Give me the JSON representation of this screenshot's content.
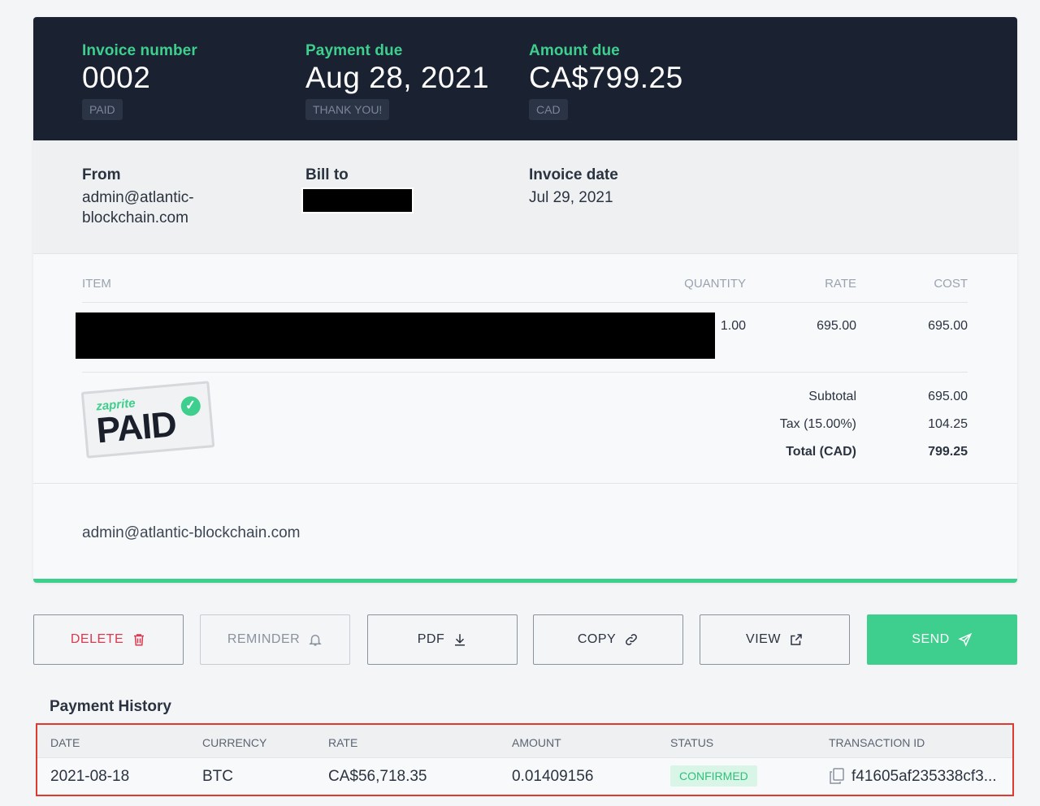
{
  "header": {
    "invoice_number": {
      "label": "Invoice number",
      "value": "0002",
      "badge": "PAID"
    },
    "payment_due": {
      "label": "Payment due",
      "value": "Aug 28, 2021",
      "badge": "THANK YOU!"
    },
    "amount_due": {
      "label": "Amount due",
      "value": "CA$799.25",
      "badge": "CAD"
    }
  },
  "billing": {
    "from_label": "From",
    "from_line1": "admin@atlantic-",
    "from_line2": "blockchain.com",
    "bill_to_label": "Bill to",
    "invoice_date_label": "Invoice date",
    "invoice_date": "Jul 29, 2021"
  },
  "items": {
    "columns": [
      "ITEM",
      "QUANTITY",
      "RATE",
      "COST"
    ],
    "rows": [
      {
        "quantity": "1.00",
        "rate": "695.00",
        "cost": "695.00"
      }
    ]
  },
  "totals": {
    "subtotal_label": "Subtotal",
    "subtotal": "695.00",
    "tax_label": "Tax (15.00%)",
    "tax": "104.25",
    "total_label": "Total (CAD)",
    "total": "799.25"
  },
  "stamp": {
    "brand": "zaprite",
    "text": "PAID"
  },
  "footer": {
    "email": "admin@atlantic-blockchain.com"
  },
  "actions": {
    "delete": "DELETE",
    "reminder": "REMINDER",
    "pdf": "PDF",
    "copy": "COPY",
    "view": "VIEW",
    "send": "SEND"
  },
  "payment_history": {
    "title": "Payment History",
    "columns": [
      "DATE",
      "CURRENCY",
      "RATE",
      "AMOUNT",
      "STATUS",
      "TRANSACTION ID"
    ],
    "rows": [
      {
        "date": "2021-08-18",
        "currency": "BTC",
        "rate": "CA$56,718.35",
        "amount": "0.01409156",
        "status": "CONFIRMED",
        "transaction_id": "f41605af235338cf3..."
      }
    ]
  },
  "colors": {
    "accent": "#3ecf8e",
    "header_bg": "#1a2232",
    "danger": "#d93a4f",
    "highlight": "#e03a2e"
  },
  "icons": [
    "trash-icon",
    "bell-icon",
    "download-icon",
    "link-icon",
    "external-link-icon",
    "send-icon",
    "copy-icon",
    "check-icon"
  ]
}
